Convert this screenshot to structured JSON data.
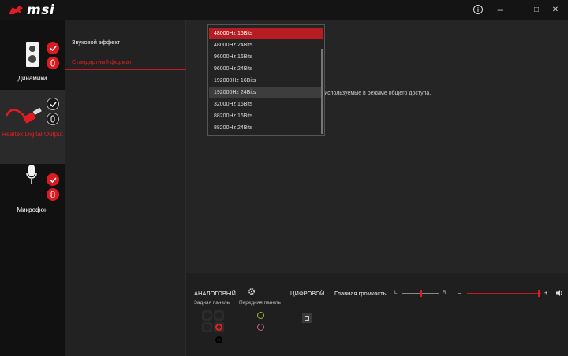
{
  "app": {
    "logo_text": "msi"
  },
  "window_controls": {
    "info": "i",
    "minimize": "–",
    "maximize": "□",
    "close": "✕"
  },
  "sidebar": {
    "devices": [
      {
        "label": "Динамики",
        "icon": "speaker-icon"
      },
      {
        "label": "Realtek Digital Output",
        "icon": "cable-icon"
      },
      {
        "label": "Микрофон",
        "icon": "microphone-icon"
      }
    ]
  },
  "menu": {
    "items": [
      {
        "label": "Звуковой эффект"
      },
      {
        "label": "Стандартный формат"
      }
    ]
  },
  "content": {
    "description_tail": "сть, используемые в режиме общего доступа."
  },
  "format_dropdown": {
    "options": [
      "48000Hz 16Bits",
      "48000Hz 24Bits",
      "96000Hz 16Bits",
      "96000Hz 24Bits",
      "192000Hz 16Bits",
      "192000Hz 24Bits",
      "32000Hz 16Bits",
      "88200Hz 16Bits",
      "88200Hz 24Bits"
    ],
    "selected": "48000Hz 16Bits",
    "hovered": "192000Hz 24Bits"
  },
  "bottom": {
    "analog_label": "АНАЛОГОВЫЙ",
    "digital_label": "ЦИФРОВОЙ",
    "rear_panel": "Задняя панель",
    "front_panel": "Передняя панель",
    "master_volume": "Главная громкость",
    "balance_left": "L",
    "balance_right": "R",
    "vol_minus": "–",
    "vol_plus": "+",
    "balance": 0.5,
    "volume": 1.0
  },
  "colors": {
    "accent": "#d91c22",
    "jack_red": "#e0201f",
    "jack_green": "#a8b040",
    "jack_pink": "#c0608a"
  }
}
